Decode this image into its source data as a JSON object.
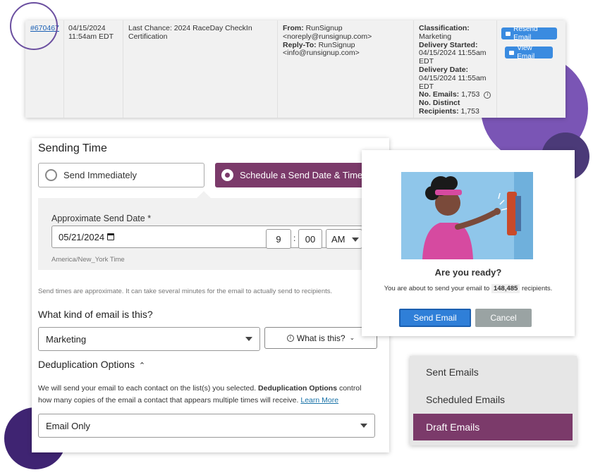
{
  "email_log": {
    "id": "#670467",
    "date": "04/15/2024",
    "time": "11:54am EDT",
    "subject": "Last Chance: 2024 RaceDay CheckIn Certification",
    "from_label": "From:",
    "from_name": "RunSignup",
    "from_email": "<noreply@runsignup.com>",
    "reply_label": "Reply-To:",
    "reply_name": "RunSignup",
    "reply_email": "<info@runsignup.com>",
    "classification_label": "Classification:",
    "classification": "Marketing",
    "delivery_started_label": "Delivery Started:",
    "delivery_started": "04/15/2024 11:55am EDT",
    "delivery_date_label": "Delivery Date:",
    "delivery_date": "04/15/2024 11:55am EDT",
    "num_emails_label": "No. Emails:",
    "num_emails": "1,753",
    "distinct_label_1": "No. Distinct",
    "distinct_label_2": "Recipients:",
    "distinct": "1,753",
    "resend_label": "Resend Email",
    "view_label": "View Email"
  },
  "sending": {
    "title": "Sending Time",
    "option_immediate": "Send Immediately",
    "option_schedule": "Schedule a Send Date & Time",
    "date_label": "Approximate Send Date *",
    "date_value": "05/21/2024",
    "hour": "9",
    "minute": "00",
    "ampm": "AM",
    "timezone": "America/New_York Time",
    "note": "Send times are approximate. It can take several minutes for the email to actually send to recipients.",
    "kind_title": "What kind of email is this?",
    "kind_value": "Marketing",
    "what_is_this": "What is this?",
    "dedup_title": "Deduplication Options",
    "dedup_text_1": "We will send your email to each contact on the list(s) you selected.",
    "dedup_bold": "Deduplication Options",
    "dedup_text_2": "control how many copies of the email a contact that appears multiple times will receive.",
    "learn_more": "Learn More",
    "dedup_value": "Email Only"
  },
  "dialog": {
    "title": "Are you ready?",
    "msg_prefix": "You are about to send your email to",
    "count": "148,485",
    "msg_suffix": "recipients.",
    "send_label": "Send Email",
    "cancel_label": "Cancel"
  },
  "nav": {
    "items": [
      "Sent Emails",
      "Scheduled Emails",
      "Draft Emails"
    ],
    "active_index": 2
  },
  "colors": {
    "brand_purple": "#7b3a6a",
    "primary_blue": "#2f7fd8",
    "cancel_gray": "#9aa3a3"
  }
}
